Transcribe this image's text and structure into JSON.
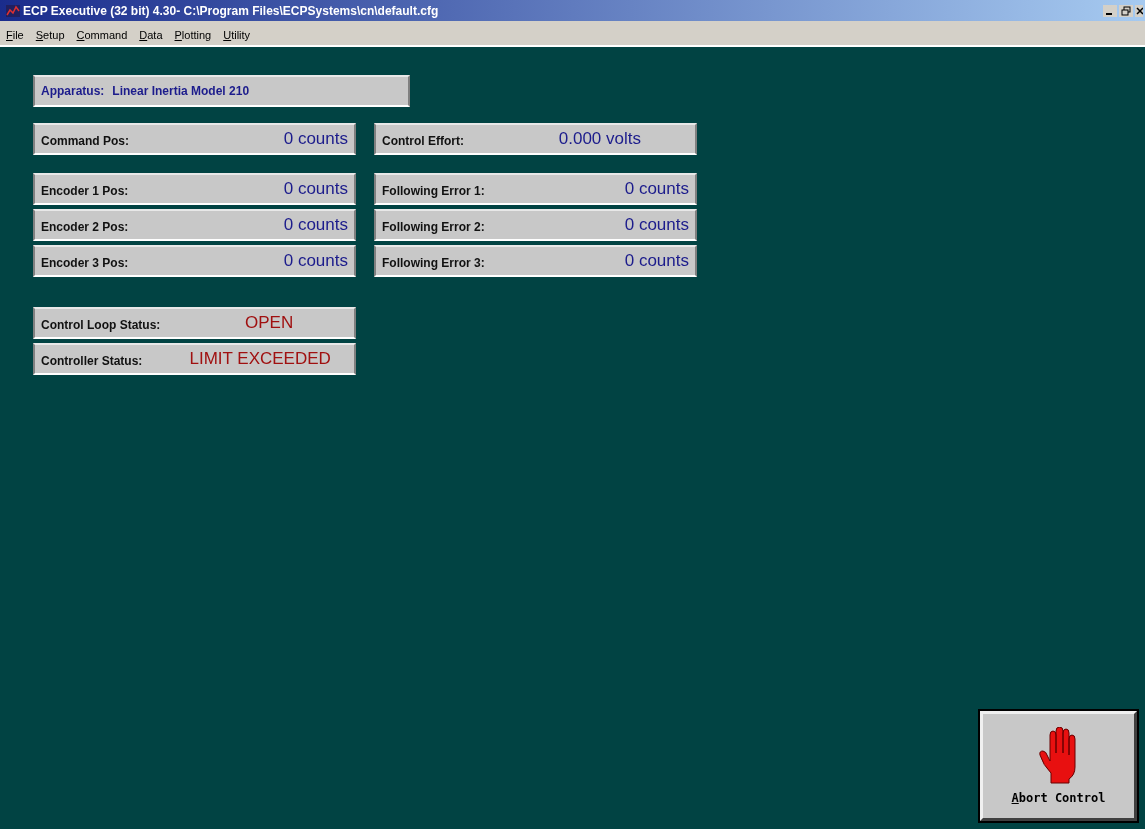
{
  "window": {
    "title": "ECP Executive (32 bit) 4.30- C:\\Program Files\\ECPSystems\\cn\\default.cfg"
  },
  "menu": [
    "File",
    "Setup",
    "Command",
    "Data",
    "Plotting",
    "Utility"
  ],
  "apparatus": {
    "label": "Apparatus:",
    "value": "Linear Inertia Model 210"
  },
  "left_readouts": [
    {
      "label": "Command Pos:",
      "value": "0 counts"
    },
    {
      "label": "Encoder 1 Pos:",
      "value": "0 counts"
    },
    {
      "label": "Encoder 2 Pos:",
      "value": "0 counts"
    },
    {
      "label": "Encoder 3 Pos:",
      "value": "0 counts"
    }
  ],
  "right_readouts": [
    {
      "label": "Control Effort:",
      "value": "0.000 volts"
    },
    {
      "label": "Following Error 1:",
      "value": "0 counts"
    },
    {
      "label": "Following Error 2:",
      "value": "0 counts"
    },
    {
      "label": "Following Error 3:",
      "value": "0 counts"
    }
  ],
  "status": [
    {
      "label": "Control Loop Status:",
      "value": "OPEN"
    },
    {
      "label": "Controller Status:",
      "value": "LIMIT EXCEEDED"
    }
  ],
  "abort_button": {
    "label": "Abort Control"
  }
}
